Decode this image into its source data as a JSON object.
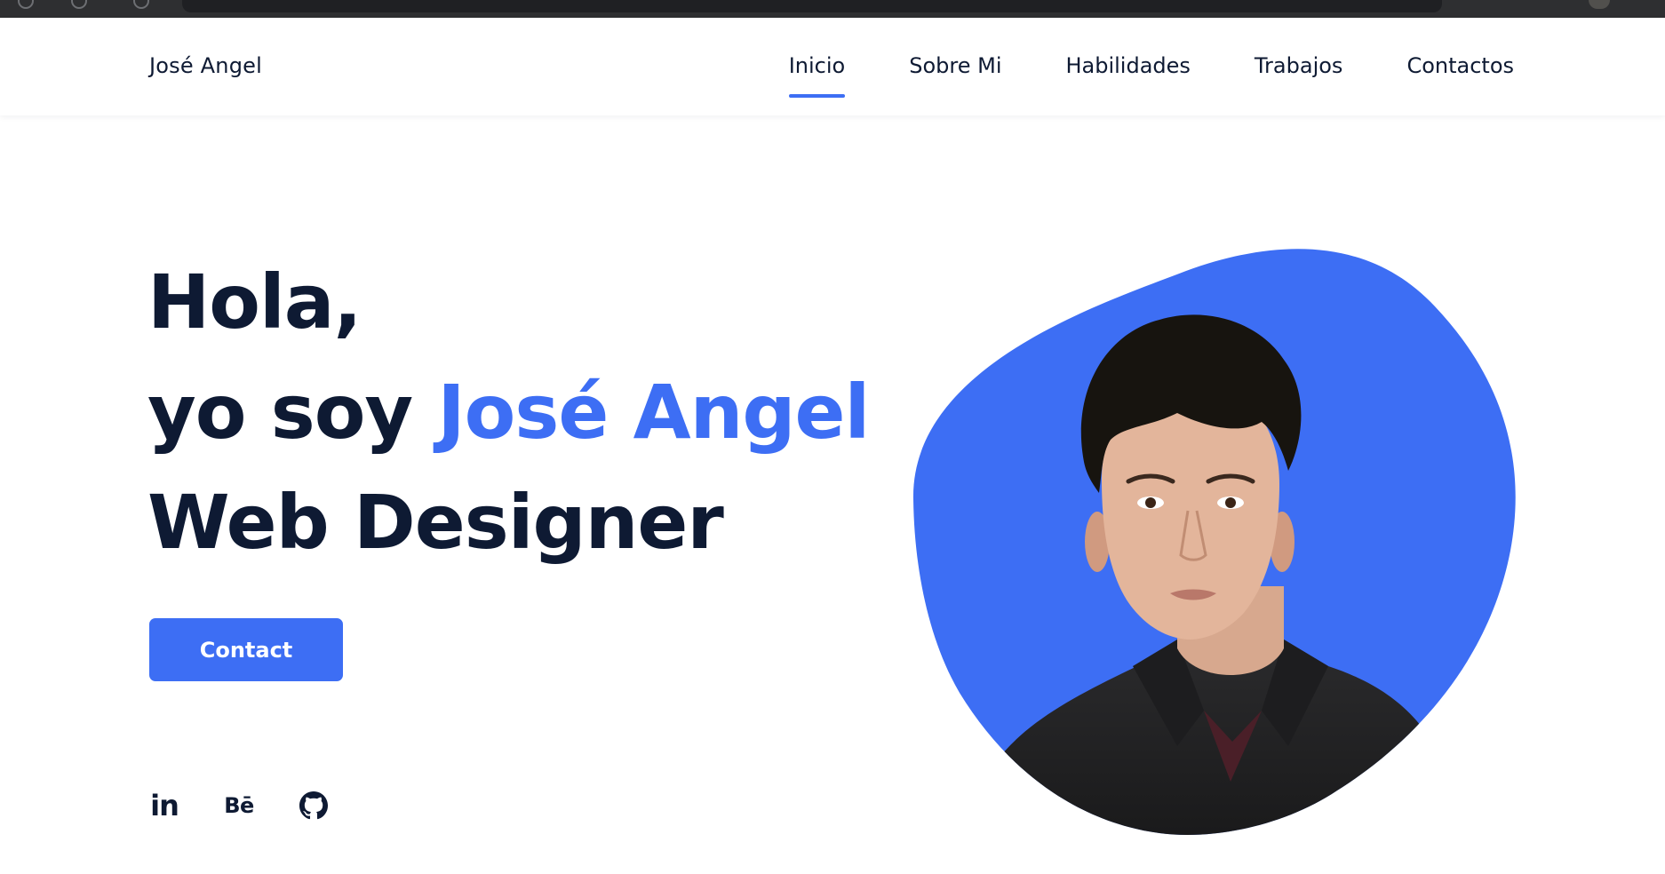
{
  "site": {
    "logo": "José Angel"
  },
  "nav": {
    "items": [
      {
        "label": "Inicio",
        "active": true
      },
      {
        "label": "Sobre Mi",
        "active": false
      },
      {
        "label": "Habilidades",
        "active": false
      },
      {
        "label": "Trabajos",
        "active": false
      },
      {
        "label": "Contactos",
        "active": false
      }
    ]
  },
  "hero": {
    "line1": "Hola,",
    "line2_prefix": "yo soy ",
    "line2_name": "José Angel",
    "line3": "Web Designer",
    "button_label": "Contact"
  },
  "socials": [
    {
      "icon": "linkedin-icon",
      "glyph": "in"
    },
    {
      "icon": "behance-icon",
      "glyph": "Bē"
    },
    {
      "icon": "github-icon"
    }
  ],
  "colors": {
    "accent": "#3d6ef4",
    "text_dark": "#0e1a33",
    "background": "#ffffff",
    "browser_bar": "#2e2f31"
  }
}
